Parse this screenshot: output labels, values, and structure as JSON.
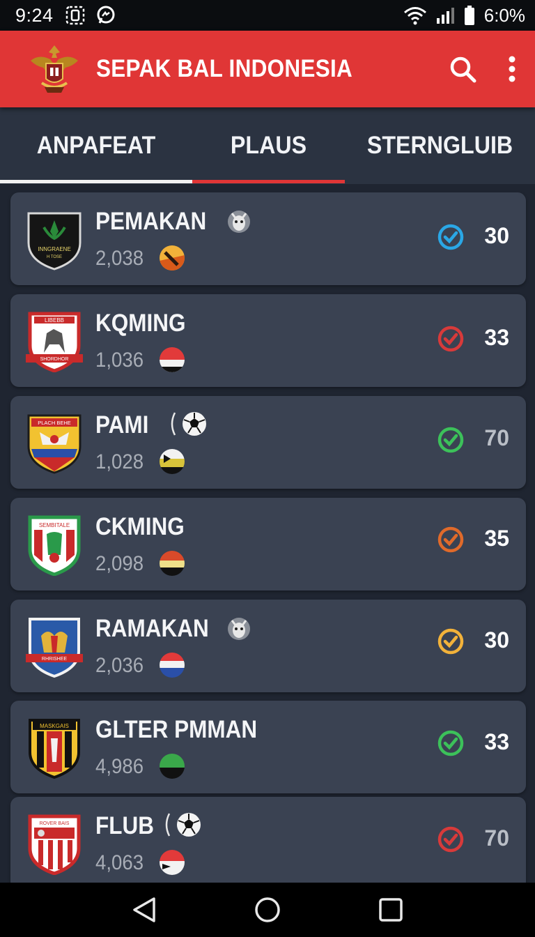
{
  "status_bar": {
    "time": "9:24",
    "battery_pct": "6:0%",
    "left_icons": [
      "sim-card-icon",
      "messenger-icon"
    ],
    "right_icons": [
      "wifi-icon",
      "signal-icon",
      "battery-icon"
    ]
  },
  "app_bar": {
    "title": "SEPAK BAL INDONESIA",
    "logo": "garuda-crest-icon",
    "actions": [
      "search-icon",
      "more-vert-icon"
    ]
  },
  "tabs": [
    {
      "label": "ANPAFEAT",
      "selected": false
    },
    {
      "label": "PLAUS",
      "selected": true
    },
    {
      "label": "STERNGLUIB",
      "selected": false
    }
  ],
  "clubs": [
    {
      "name": "PEMAKAN",
      "count": "2,038",
      "score": "30",
      "status_color": "#2aa7e6",
      "extra_icon": "goat-icon",
      "crest_color": "#1b1b1b",
      "crest_text": "INNGRAENE",
      "crest_subtext": "H TOSE"
    },
    {
      "name": "KQMING",
      "count": "1,036",
      "score": "33",
      "status_color": "#d83a3a",
      "extra_icon": "",
      "crest_color": "#ffffff",
      "crest_text": "LIBEBB",
      "crest_subtext": "SHORDHOR"
    },
    {
      "name": "PAMI",
      "count": "1,028",
      "score": "70",
      "status_color": "#3cc15a",
      "extra_icon": "soccer-ball-icon",
      "crest_color": "#f2c230",
      "crest_text": "PLACH BEHE",
      "crest_subtext": ""
    },
    {
      "name": "CKMING",
      "count": "2,098",
      "score": "35",
      "status_color": "#e06a2a",
      "extra_icon": "",
      "crest_color": "#ffffff",
      "crest_text": "SEMBITALE",
      "crest_subtext": ""
    },
    {
      "name": "RAMAKAN",
      "count": "2,036",
      "score": "30",
      "status_color": "#f2b23a",
      "extra_icon": "goat-icon",
      "crest_color": "#2a5aa8",
      "crest_text": "",
      "crest_subtext": "RHRISHEE"
    },
    {
      "name": "GLTER PMMAN",
      "count": "4,986",
      "score": "33",
      "status_color": "#3cc15a",
      "extra_icon": "",
      "crest_color": "#f2c230",
      "crest_text": "MASKGAIS",
      "crest_subtext": ""
    },
    {
      "name": "FLUB",
      "count": "4,063",
      "score": "70",
      "status_color": "#d83a3a",
      "extra_icon": "soccer-ball-icon",
      "crest_color": "#ffffff",
      "crest_text": "ROVER BAIS",
      "crest_subtext": ""
    }
  ],
  "nav_bar": {
    "buttons": [
      "back-icon",
      "home-icon",
      "recents-icon"
    ]
  },
  "colors": {
    "app_bar": "#e03636",
    "tab_bar": "#2b3341",
    "card": "#3a4252",
    "background": "#1f2531"
  }
}
